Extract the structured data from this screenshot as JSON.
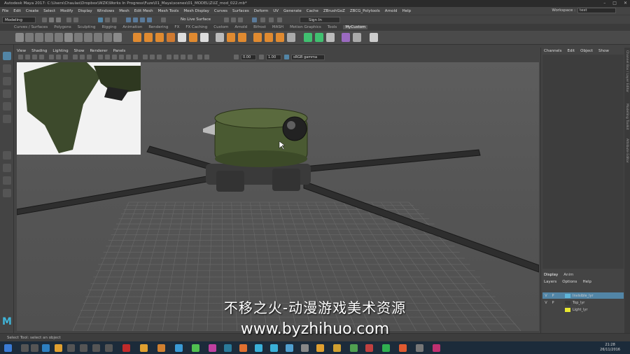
{
  "window": {
    "title": "Autodesk Maya 2017: C:\\Users\\Chaulas\\Dropbox\\WZK\\Works In Progress\\Fuze\\01_Maya\\scenes\\01_MODEL\\ZUZ_mod_022.mb*",
    "controls": [
      "–",
      "□",
      "✕"
    ]
  },
  "menubar": {
    "items": [
      "File",
      "Edit",
      "Create",
      "Select",
      "Modify",
      "Display",
      "Windows",
      "Mesh",
      "Edit Mesh",
      "Mesh Tools",
      "Mesh Display",
      "Curves",
      "Surfaces",
      "Deform",
      "UV",
      "Generate",
      "Cache",
      "ZBrushGoZ",
      "ZBCG_Polytools",
      "Arnold",
      "Help"
    ],
    "workspace_label": "Workspace :",
    "workspace_value": "test"
  },
  "statusline": {
    "mode": "Modeling",
    "no_live_surface": "No Live Surface",
    "sign_in": "Sign In"
  },
  "shelf": {
    "tabs": [
      "Curves / Surfaces",
      "Polygons",
      "Sculpting",
      "Rigging",
      "Animation",
      "Rendering",
      "FX",
      "FX Caching",
      "Custom",
      "Arnold",
      "Bifrost",
      "MASH",
      "Motion Graphics",
      "Tools",
      "MyCustom"
    ],
    "active_tab": "MyCustom"
  },
  "panel": {
    "menus": [
      "View",
      "Shading",
      "Lighting",
      "Show",
      "Renderer",
      "Panels"
    ],
    "field_a": "0.00",
    "field_b": "1.00",
    "color_space": "sRGB gamma"
  },
  "channel_box": {
    "menus": [
      "Channels",
      "Edit",
      "Object",
      "Show"
    ],
    "side_tabs": [
      "Channel Box / Layer Editor",
      "Modelling Toolkit",
      "Attribute Editor"
    ],
    "layer_tabs": [
      "Display",
      "Anim"
    ],
    "layer_menus": [
      "Layers",
      "Options",
      "Help"
    ],
    "layers": [
      {
        "v": "V",
        "p": "P",
        "name": "Invisible_lyr",
        "color": "#5fb5d8",
        "selected": true
      },
      {
        "v": "V",
        "p": "P",
        "name": "Top_lyr",
        "color": "#3a3a3a",
        "selected": false
      },
      {
        "v": "",
        "p": "",
        "name": "Light_lyr",
        "color": "#e8e830",
        "selected": false
      }
    ]
  },
  "status_help": "Select Tool: select an object",
  "taskbar": {
    "time": "21:28",
    "date": "26/11/2016"
  },
  "watermark": {
    "line1": "不移之火-动漫游戏美术资源",
    "line2": "www.byzhihuo.com"
  }
}
